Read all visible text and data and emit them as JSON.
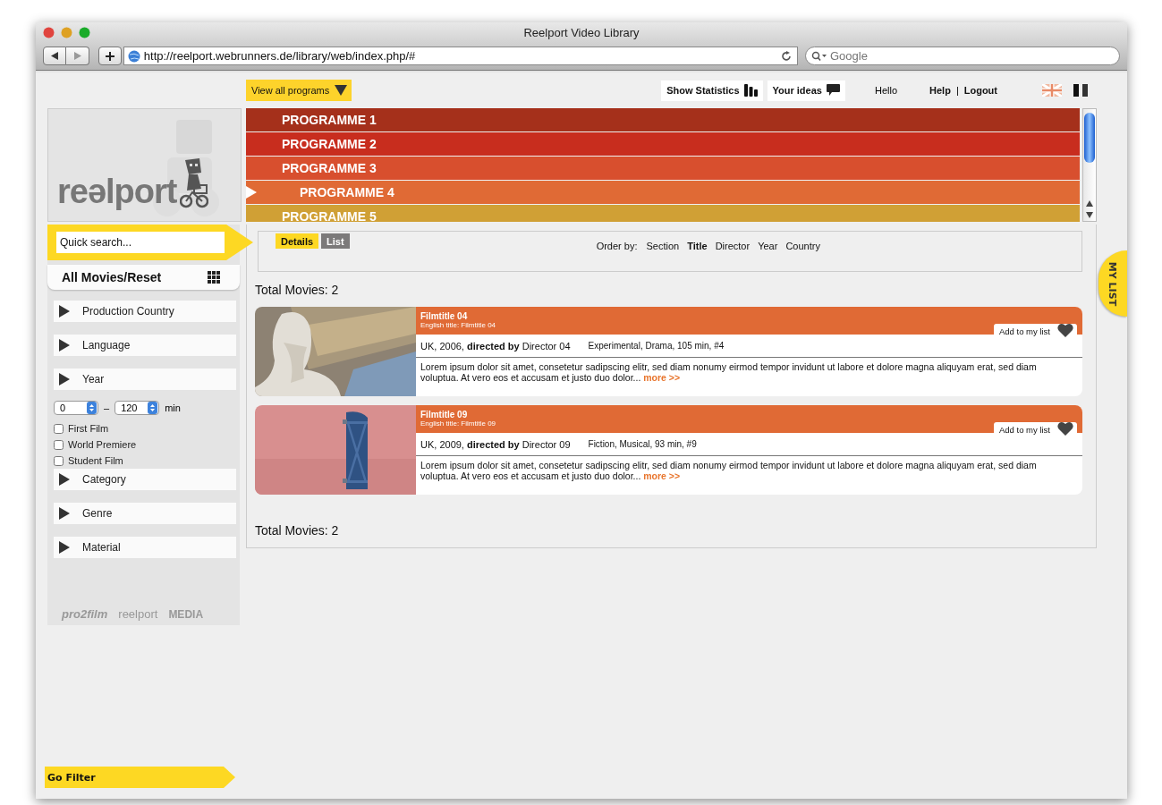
{
  "window": {
    "title": "Reelport Video Library",
    "url": "http://reelport.webrunners.de/library/web/index.php/#",
    "search_placeholder": "Google"
  },
  "topbar": {
    "programs_button": "View all programs",
    "statistics_button": "Show Statistics",
    "ideas_button": "Your ideas",
    "greeting": "Hello",
    "help_link": "Help",
    "separator": "|",
    "logout_link": "Logout"
  },
  "logo": {
    "wordmark": "reəlport"
  },
  "programmes": [
    {
      "label": "PROGRAMME 1",
      "color": "#a5301b",
      "selected": false
    },
    {
      "label": "PROGRAMME 2",
      "color": "#c82d1e",
      "selected": false
    },
    {
      "label": "PROGRAMME 3",
      "color": "#d84f2e",
      "selected": false
    },
    {
      "label": "PROGRAMME 4",
      "color": "#e06a35",
      "selected": true
    },
    {
      "label": "PROGRAMME 5",
      "color": "#d0a035",
      "selected": false
    }
  ],
  "sidebar": {
    "search_placeholder": "Quick search...",
    "reset_button": "All Movies/Reset",
    "filters": [
      {
        "kind": "section",
        "label": "Production Country"
      },
      {
        "kind": "section",
        "label": "Language"
      },
      {
        "kind": "section",
        "label": "Year"
      },
      {
        "kind": "duration",
        "from": "0",
        "separator": "–",
        "to": "120",
        "unit": "min"
      },
      {
        "kind": "checkbox",
        "label": "First Film",
        "checked": false
      },
      {
        "kind": "checkbox",
        "label": "World Premiere",
        "checked": false
      },
      {
        "kind": "checkbox",
        "label": "Student Film",
        "checked": false
      },
      {
        "kind": "section",
        "label": "Category"
      },
      {
        "kind": "section",
        "label": "Genre"
      },
      {
        "kind": "section",
        "label": "Material"
      }
    ],
    "partner_logos": [
      "pro2film",
      "reelport",
      "MEDIA"
    ],
    "go_button": "Go Filter"
  },
  "view_tabs": [
    {
      "label": "Details",
      "selected": true
    },
    {
      "label": "List",
      "selected": false
    }
  ],
  "order_by": {
    "label": "Order by:",
    "options": [
      {
        "label": "Section",
        "selected": false
      },
      {
        "label": "Title",
        "selected": true
      },
      {
        "label": "Director",
        "selected": false
      },
      {
        "label": "Year",
        "selected": false
      },
      {
        "label": "Country",
        "selected": false
      }
    ]
  },
  "total_top": "Total Movies: 2",
  "movies": [
    {
      "title": "Filmtitle 04",
      "english_title": "English title: Filmtitle 04",
      "add_button": "Add to my list",
      "meta": "UK, 2006, **directed by** Director 04",
      "genres": "Experimental, Drama, 105 min, #4",
      "description": "Lorem ipsum dolor sit amet, consetetur sadipscing elitr, sed diam nonumy eirmod tempor invidunt ut labore et dolore magna aliquyam erat, sed diam voluptua. At vero eos et accusam et justo duo dolor...",
      "more_link": "more >>",
      "kind": "picture"
    },
    {
      "title": "Filmtitle 09",
      "english_title": "English title: Filmtitle 09",
      "add_button": "Add to my list",
      "meta": "UK, 2009, **directed by** Director 09",
      "genres": "Fiction, Musical, 93 min, #9",
      "description": "Lorem ipsum dolor sit amet, consetetur sadipscing elitr, sed diam nonumy eirmod tempor invidunt ut labore et dolore magna aliquyam erat, sed diam voluptua. At vero eos et accusam et justo duo dolor...",
      "more_link": "more >>",
      "kind": "picture"
    }
  ],
  "total_bottom": "Total Movies: 2",
  "my_list_tab": "MY LIST"
}
